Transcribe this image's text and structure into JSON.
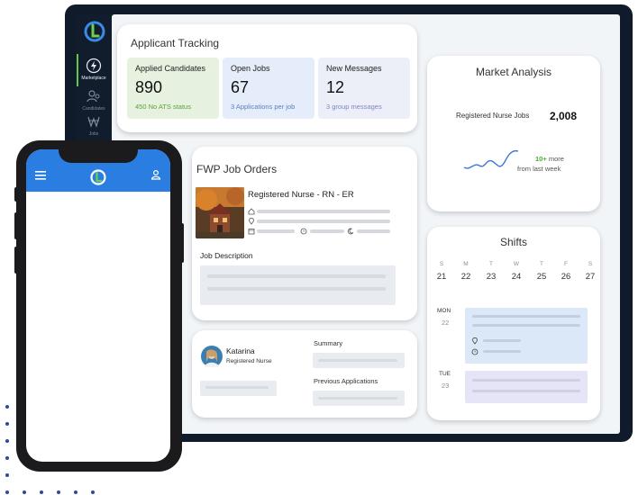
{
  "sidebar": {
    "items": [
      {
        "label": "Marketplace",
        "icon": "lightning-icon"
      },
      {
        "label": "Candidates",
        "icon": "users-icon"
      },
      {
        "label": "Jobs",
        "icon": "briefcase-icon"
      }
    ]
  },
  "applicant_tracking": {
    "title": "Applicant Tracking",
    "stats": [
      {
        "label": "Applied Candidates",
        "value": "890",
        "sub": "450 No ATS status",
        "bg": "#e6f2df",
        "sub_color": "#5aa33c"
      },
      {
        "label": "Open Jobs",
        "value": "67",
        "sub": "3 Applications per job",
        "bg": "#e4edf9",
        "sub_color": "#5a7fc4"
      },
      {
        "label": "New Messages",
        "value": "12",
        "sub": "3 group messages",
        "bg": "#eceff8",
        "sub_color": "#7d86c2"
      }
    ]
  },
  "market_analysis": {
    "title": "Market Analysis",
    "metric_label": "Registered Nurse Jobs",
    "metric_value": "2,008",
    "trend_highlight": "10+",
    "trend_more": "more",
    "trend_sub": "from last week",
    "trend_color": "#4caf2a",
    "line_color": "#3b78d6"
  },
  "job_orders": {
    "title": "FWP Job Orders",
    "job_title": "Registered Nurse - RN - ER",
    "description_label": "Job Description"
  },
  "candidate": {
    "name": "Katarina",
    "role": "Registered Nurse",
    "summary_label": "Summary",
    "previous_label": "Previous Applications"
  },
  "shifts": {
    "title": "Shifts",
    "days": [
      {
        "d": "S",
        "n": "21"
      },
      {
        "d": "M",
        "n": "22"
      },
      {
        "d": "T",
        "n": "23"
      },
      {
        "d": "W",
        "n": "24"
      },
      {
        "d": "T",
        "n": "25"
      },
      {
        "d": "F",
        "n": "26"
      },
      {
        "d": "S",
        "n": "27"
      }
    ],
    "entries": [
      {
        "day": "MON",
        "date": "22",
        "color": "#dbe8f8"
      },
      {
        "day": "TUE",
        "date": "23",
        "color": "#e6e5f8"
      }
    ]
  },
  "phone": {
    "accent": "#2a7de1"
  }
}
